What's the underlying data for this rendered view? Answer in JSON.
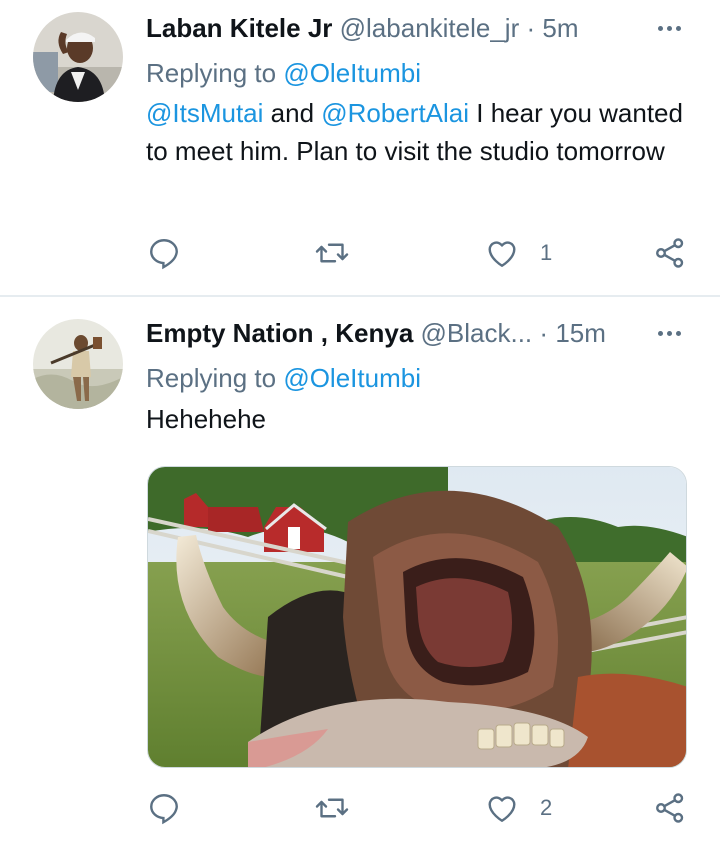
{
  "tweets": [
    {
      "name": "Laban Kitele Jr",
      "handle": "@labankitele_jr",
      "dot": "·",
      "time": "5m",
      "replying_prefix": "Replying to",
      "replying_to": "@OleItumbi",
      "body": {
        "mention1": "@ItsMutai",
        "and": " and ",
        "mention2": "@RobertAlai",
        "text": " I hear you wanted to meet him. Plan to visit the studio tomorrow"
      },
      "actions": {
        "reply_count": "",
        "retweet_count": "",
        "like_count": "1"
      },
      "icons": {
        "reply": "reply-icon",
        "retweet": "retweet-icon",
        "like": "heart-icon",
        "share": "share-icon",
        "more": "more-icon"
      }
    },
    {
      "name": "Empty Nation , Kenya",
      "handle": "@Black...",
      "dot": "·",
      "time": "15m",
      "replying_prefix": "Replying to",
      "replying_to": "@OleItumbi",
      "body": {
        "text": "Hehehehe"
      },
      "actions": {
        "reply_count": "",
        "retweet_count": "",
        "like_count": "2"
      },
      "icons": {
        "reply": "reply-icon",
        "retweet": "retweet-icon",
        "like": "heart-icon",
        "share": "share-icon",
        "more": "more-icon"
      }
    }
  ],
  "colors": {
    "link": "#1b95e0",
    "secondary": "#5b7083",
    "text": "#0f1419",
    "divider": "#e6ecf0"
  }
}
